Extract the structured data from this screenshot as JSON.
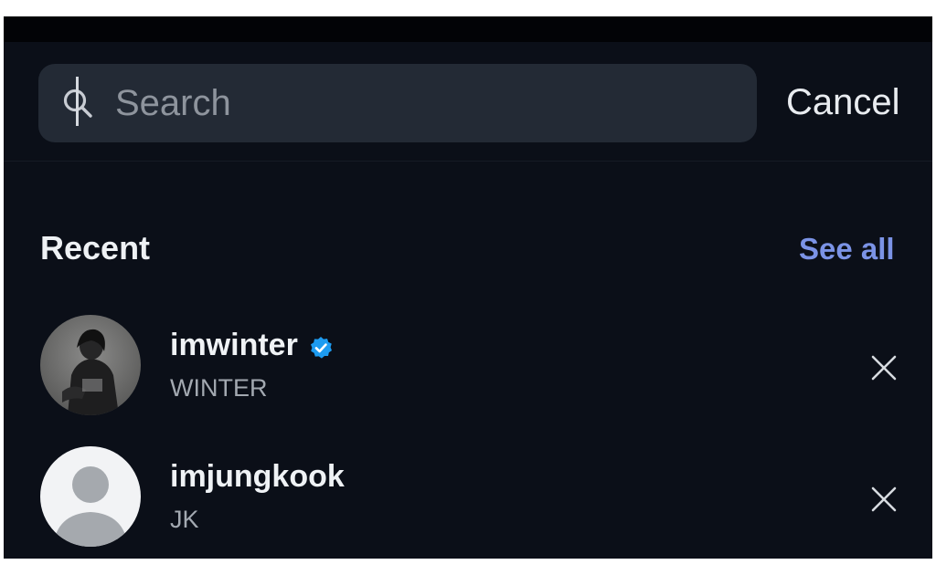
{
  "search": {
    "placeholder": "Search",
    "value": ""
  },
  "header": {
    "cancel_label": "Cancel"
  },
  "recent": {
    "title": "Recent",
    "see_all_label": "See all",
    "items": [
      {
        "username": "imwinter",
        "display_name": "WINTER",
        "verified": true,
        "avatar": "photo-avatar"
      },
      {
        "username": "imjungkook",
        "display_name": "JK",
        "verified": false,
        "avatar": "default-avatar"
      }
    ]
  },
  "icons": {
    "search": "search-icon",
    "verified": "verified-badge-icon",
    "remove": "close-icon"
  },
  "colors": {
    "background": "#0b0f18",
    "search_field": "#232a35",
    "link": "#7b93e6",
    "verified": "#1d9bf0"
  }
}
